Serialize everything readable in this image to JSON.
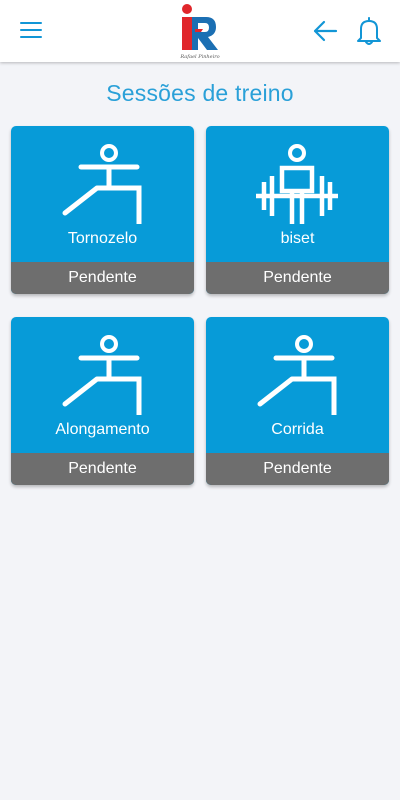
{
  "header": {
    "logo_text": "Rafael Pinheiro",
    "icons": [
      "menu-icon",
      "logo",
      "back-arrow-icon",
      "bell-icon"
    ],
    "accent_color": "#1296d6"
  },
  "page": {
    "title": "Sessões de treino"
  },
  "sessions": [
    {
      "name": "Tornozelo",
      "status": "Pendente",
      "icon": "lunge-figure-icon"
    },
    {
      "name": "biset",
      "status": "Pendente",
      "icon": "weightlifter-icon"
    },
    {
      "name": "Alongamento",
      "status": "Pendente",
      "icon": "lunge-figure-icon"
    },
    {
      "name": "Corrida",
      "status": "Pendente",
      "icon": "lunge-figure-icon"
    }
  ],
  "colors": {
    "card_bg": "#079bd8",
    "status_bg": "#6e6e6e",
    "page_bg": "#f3f4f8",
    "logo_red": "#e0262b",
    "logo_blue": "#1b6fb3"
  }
}
